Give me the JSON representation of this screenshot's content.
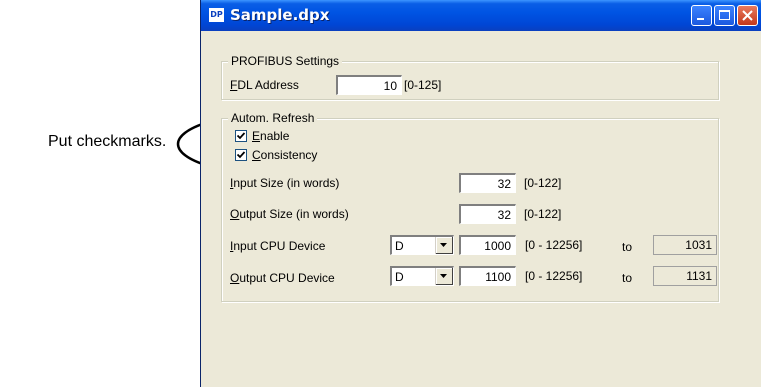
{
  "annotation": {
    "text": "Put checkmarks."
  },
  "window": {
    "icon_text": "DP",
    "title": "Sample.dpx"
  },
  "profibus": {
    "legend": "PROFIBUS Settings",
    "fdl_label_prefix": "F",
    "fdl_label_rest": "DL Address",
    "fdl_value": "10",
    "fdl_range": "[0-125]"
  },
  "refresh": {
    "legend": "Autom. Refresh",
    "enable_prefix": "E",
    "enable_rest": "nable",
    "enable_checked": true,
    "consistency_prefix": "C",
    "consistency_rest": "onsistency",
    "consistency_checked": true,
    "input_size_prefix": "I",
    "input_size_rest": "nput Size (in words)",
    "input_size_value": "32",
    "input_size_range": "[0-122]",
    "output_size_prefix": "O",
    "output_size_rest": "utput Size (in words)",
    "output_size_value": "32",
    "output_size_range": "[0-122]",
    "input_cpu_prefix": "I",
    "input_cpu_rest": "nput CPU Device",
    "input_cpu_device": "D",
    "input_cpu_start": "1000",
    "input_cpu_range": "[0 - 12256]",
    "input_cpu_to": "to",
    "input_cpu_end": "1031",
    "output_cpu_prefix": "O",
    "output_cpu_rest": "utput CPU Device",
    "output_cpu_device": "D",
    "output_cpu_start": "1100",
    "output_cpu_range": "[0 - 12256]",
    "output_cpu_to": "to",
    "output_cpu_end": "1131"
  }
}
